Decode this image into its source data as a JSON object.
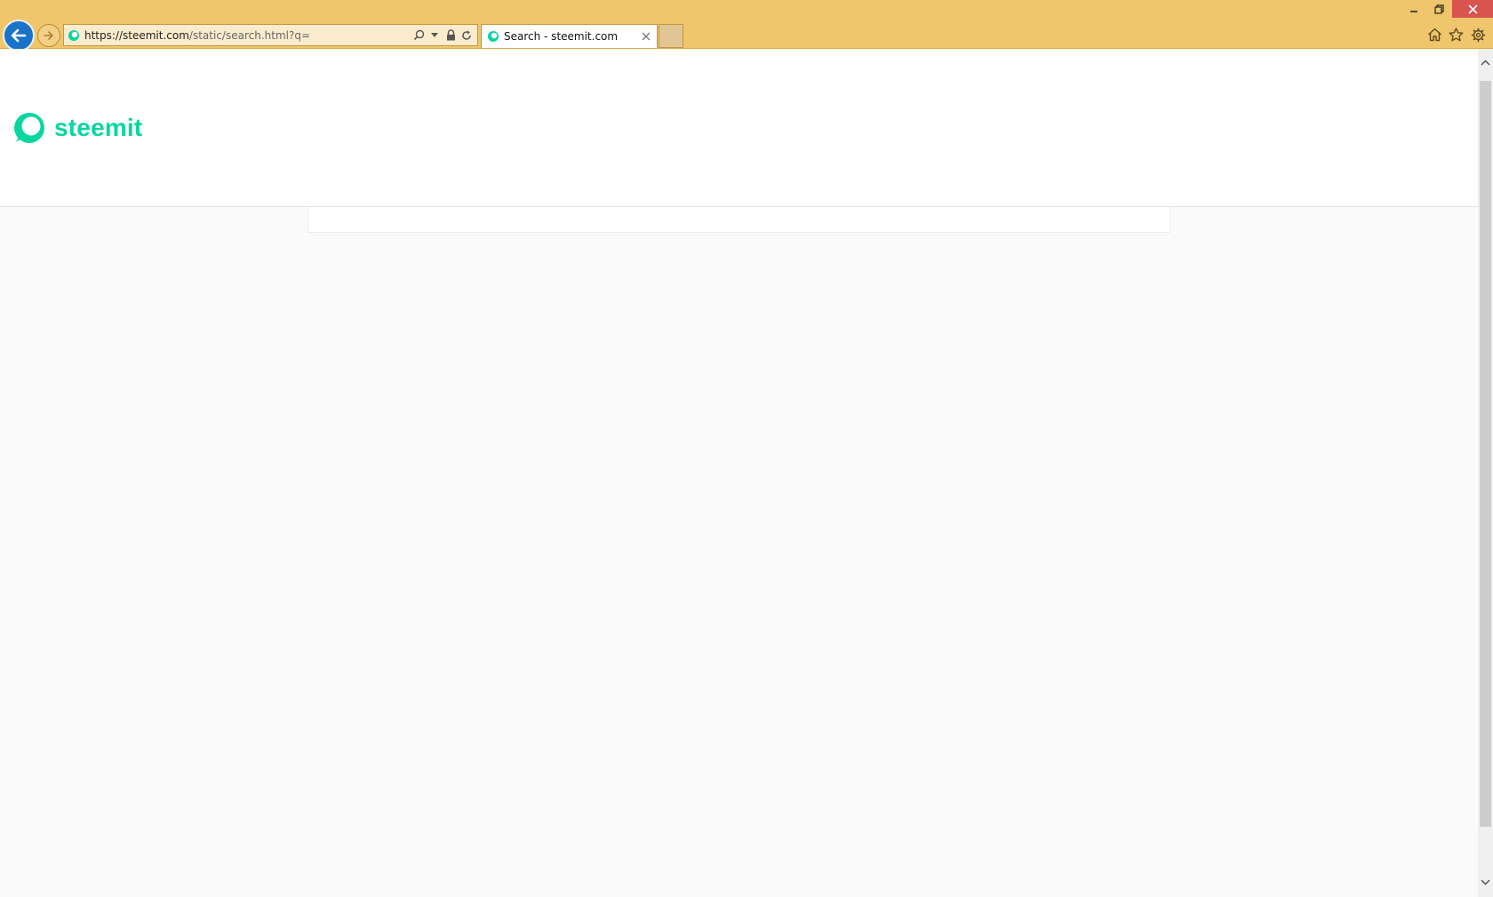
{
  "browser": {
    "address_bar": {
      "url_host": "https://steemit.com",
      "url_path": "/static/search.html?q="
    },
    "tab": {
      "title": "Search - steemit.com"
    },
    "colors": {
      "chrome": "#f0c66c",
      "back_button": "#1a73c8",
      "close_button": "#d9534f"
    },
    "icons": [
      "back-arrow-icon",
      "forward-arrow-icon",
      "site-favicon",
      "search-icon",
      "dropdown-icon",
      "lock-icon",
      "refresh-icon",
      "tab-close-icon",
      "minimize-icon",
      "restore-icon",
      "window-close-icon",
      "home-icon",
      "favorites-star-icon",
      "settings-gear-icon"
    ]
  },
  "page": {
    "logo": {
      "text": "steemit",
      "color": "#07d6a0"
    }
  }
}
